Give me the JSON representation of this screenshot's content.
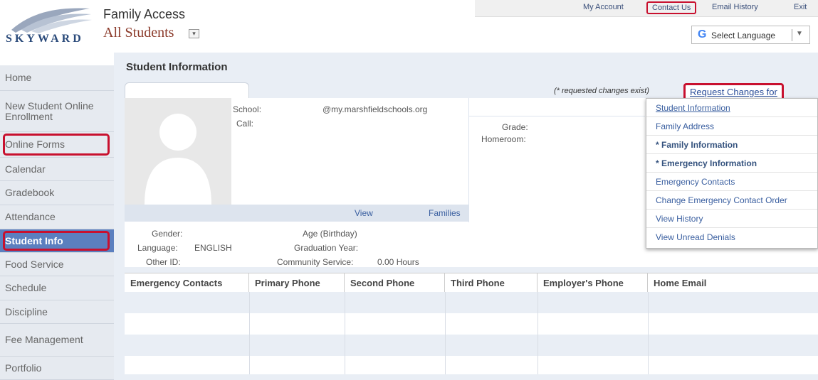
{
  "header": {
    "logo_text": "SKYWARD",
    "app_title": "Family Access",
    "student_selector": "All Students",
    "top_links": [
      "My Account",
      "Contact Us",
      "Email History",
      "Exit"
    ],
    "language": "Select Language"
  },
  "sidebar": {
    "items": [
      {
        "label": "Home"
      },
      {
        "label": "New Student Online Enrollment"
      },
      {
        "label": "Online Forms"
      },
      {
        "label": "Calendar"
      },
      {
        "label": "Gradebook"
      },
      {
        "label": "Attendance"
      },
      {
        "label": "Student Info"
      },
      {
        "label": "Food Service"
      },
      {
        "label": "Schedule"
      },
      {
        "label": "Discipline"
      },
      {
        "label": "Fee Management"
      },
      {
        "label": "Portfolio"
      }
    ],
    "selected": "Student Info"
  },
  "main": {
    "title": "Student Information",
    "requested_note": "(* requested changes exist)",
    "request_link": "Request Changes for",
    "school_label": "School:",
    "school_email": "@my.marshfieldschools.org",
    "call_label": "Call:",
    "grade_label": "Grade:",
    "homeroom_label": "Homeroom:",
    "view_link": "View",
    "families_link": "Families",
    "gender_label": "Gender:",
    "language_label": "Language:",
    "language_value": "ENGLISH",
    "other_id_label": "Other ID:",
    "age_label": "Age (Birthday)",
    "grad_label": "Graduation Year:",
    "community_label": "Community Service:",
    "community_value": "0.00 Hours"
  },
  "dropdown": {
    "items": [
      "Student Information",
      "Family Address",
      "* Family Information",
      "* Emergency Information",
      "Emergency Contacts",
      "Change Emergency Contact Order",
      "View History",
      "View Unread Denials"
    ]
  },
  "table": {
    "headers": [
      "Emergency Contacts",
      "Primary Phone",
      "Second Phone",
      "Third Phone",
      "Employer's Phone",
      "Home Email"
    ]
  },
  "colors": {
    "highlight": "#c8102e",
    "selected_nav": "#5b7fbf",
    "link": "#3a5fa0"
  }
}
